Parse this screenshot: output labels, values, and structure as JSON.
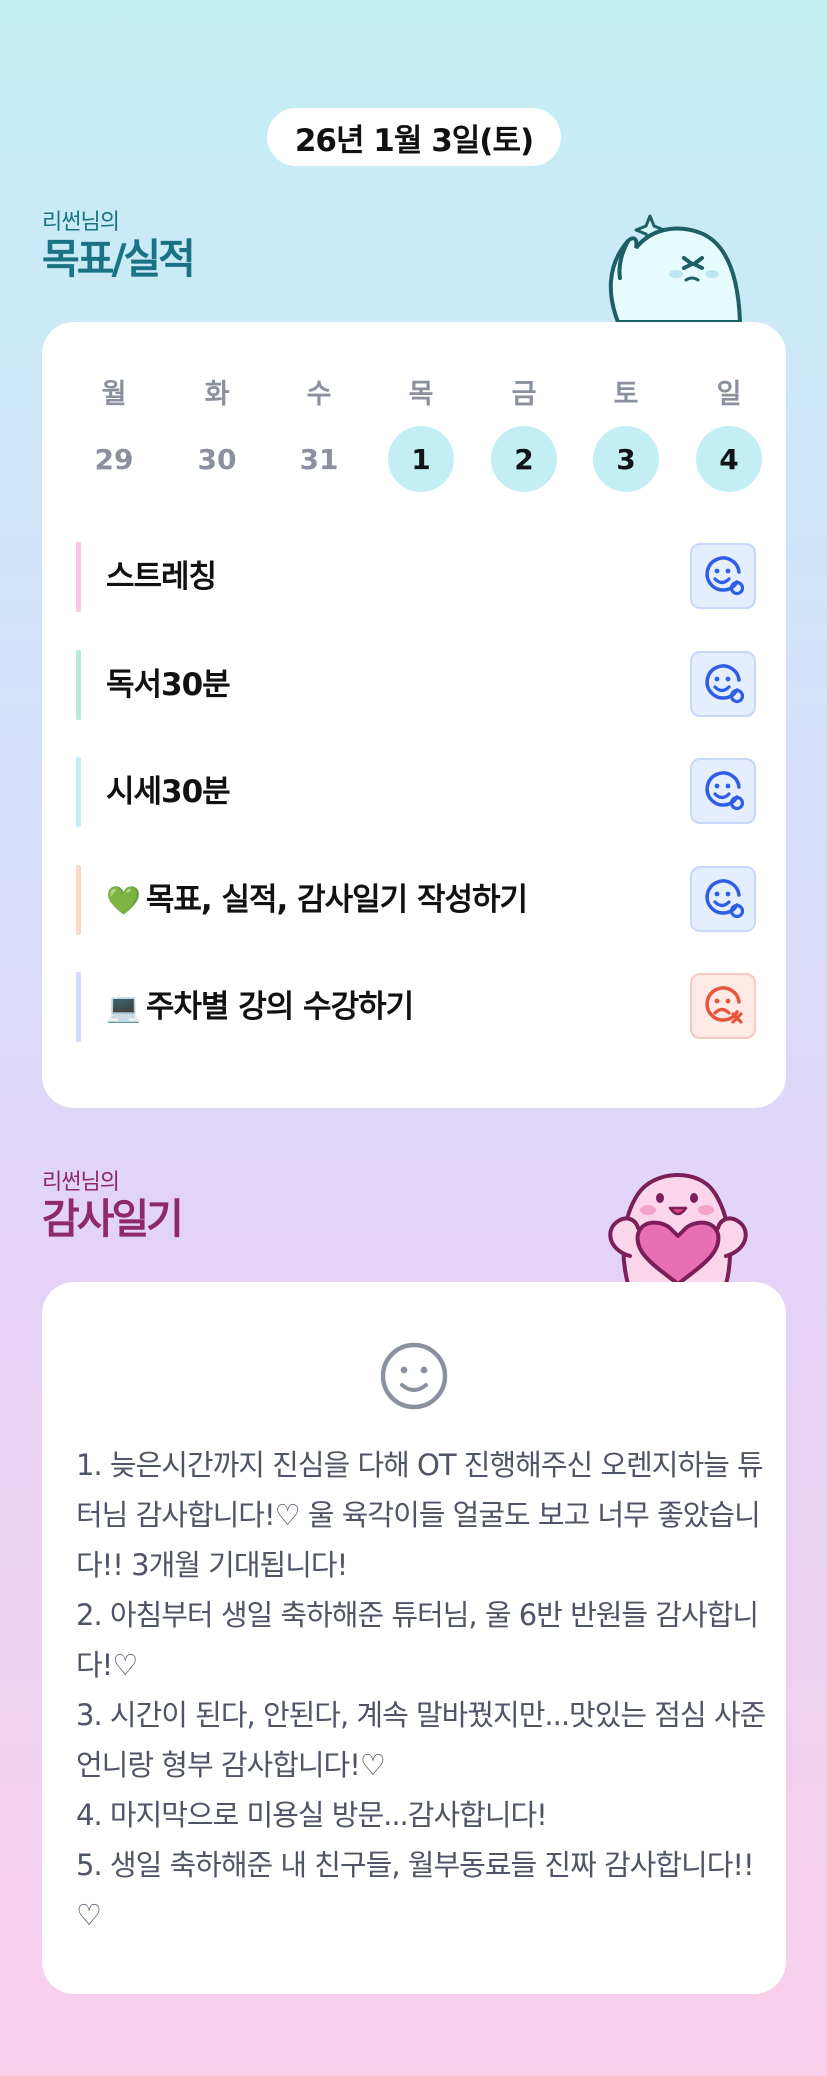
{
  "header": {
    "date": "26년 1월 3일(토)"
  },
  "goals": {
    "title_sub": "리썬님의",
    "title_main": "목표/실적",
    "week": [
      {
        "day": "월",
        "num": "29",
        "active": false
      },
      {
        "day": "화",
        "num": "30",
        "active": false
      },
      {
        "day": "수",
        "num": "31",
        "active": false
      },
      {
        "day": "목",
        "num": "1",
        "active": true
      },
      {
        "day": "금",
        "num": "2",
        "active": true
      },
      {
        "day": "토",
        "num": "3",
        "active": true
      },
      {
        "day": "일",
        "num": "4",
        "active": true
      }
    ],
    "tasks": [
      {
        "emoji": "",
        "label": "스트레칭",
        "color": "#f7c6e3",
        "status": "done",
        "status_icon": "happy-face-icon"
      },
      {
        "emoji": "",
        "label": "독서30분",
        "color": "#b5ecd8",
        "status": "done",
        "status_icon": "happy-face-icon"
      },
      {
        "emoji": "",
        "label": "시세30분",
        "color": "#c3eff4",
        "status": "done",
        "status_icon": "happy-face-icon"
      },
      {
        "emoji": "💚",
        "label": "목표, 실적, 감사일기 작성하기",
        "color": "#fbd8c6",
        "status": "done",
        "status_icon": "happy-face-icon"
      },
      {
        "emoji": "💻",
        "label": "주차별 강의 수강하기",
        "color": "#d3dcfa",
        "status": "failed",
        "status_icon": "sad-face-icon"
      }
    ],
    "colors": {
      "done": "#2f5ee6",
      "failed": "#e8553c",
      "day_active_bg": "#c3eff4"
    }
  },
  "thanks": {
    "title_sub": "리썬님의",
    "title_main": "감사일기",
    "mood_icon": "neutral-smile-icon",
    "lines": [
      "1. 늦은시간까지 진심을 다해 OT 진행해주신 오렌지하늘 튜터님 감사합니다!♡ 울 육각이들 얼굴도 보고 너무 좋았습니다!! 3개월 기대됩니다!",
      "2. 아침부터 생일 축하해준 튜터님, 울 6반 반원들 감사합니다!♡",
      "3. 시간이 된다, 안된다, 계속 말바꿨지만...맛있는 점심 사준 언니랑 형부 감사합니다!♡",
      "4. 마지막으로 미용실 방문...감사합니다!",
      "5. 생일 축하해준 내 친구들, 월부동료들 진짜 감사합니다!!♡"
    ]
  }
}
